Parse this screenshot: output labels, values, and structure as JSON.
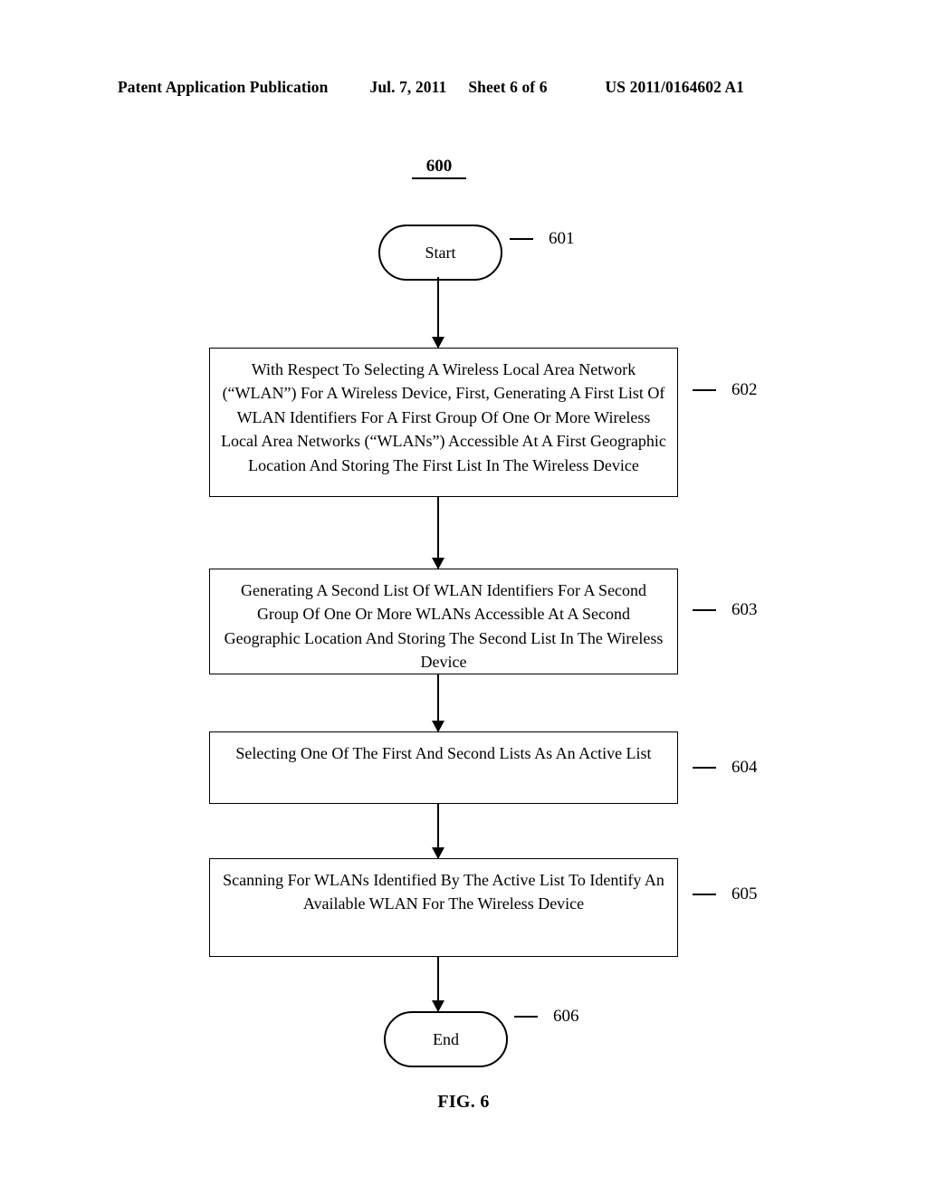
{
  "header": {
    "publication": "Patent Application Publication",
    "date": "Jul. 7, 2011",
    "sheet": "Sheet 6 of 6",
    "patent_number": "US 2011/0164602 A1"
  },
  "figure": {
    "id_label": "600",
    "caption": "FIG. 6",
    "nodes": {
      "start": {
        "label": "Start",
        "ref": "601"
      },
      "step_602": {
        "label": "With Respect To Selecting A Wireless Local Area Network (“WLAN”) For A Wireless Device, First, Generating A First List Of WLAN Identifiers For A First Group Of One Or More Wireless Local Area Networks (“WLANs”) Accessible At A First Geographic Location And Storing The First List In The Wireless Device",
        "ref": "602"
      },
      "step_603": {
        "label": "Generating A Second List Of WLAN Identifiers For A Second Group Of One Or More WLANs Accessible At A Second Geographic Location And Storing The Second List In The Wireless Device",
        "ref": "603"
      },
      "step_604": {
        "label": "Selecting One Of The First And Second Lists As An Active List",
        "ref": "604"
      },
      "step_605": {
        "label": "Scanning For WLANs Identified By The Active List To Identify An Available WLAN For The Wireless Device",
        "ref": "605"
      },
      "end": {
        "label": "End",
        "ref": "606"
      }
    }
  }
}
